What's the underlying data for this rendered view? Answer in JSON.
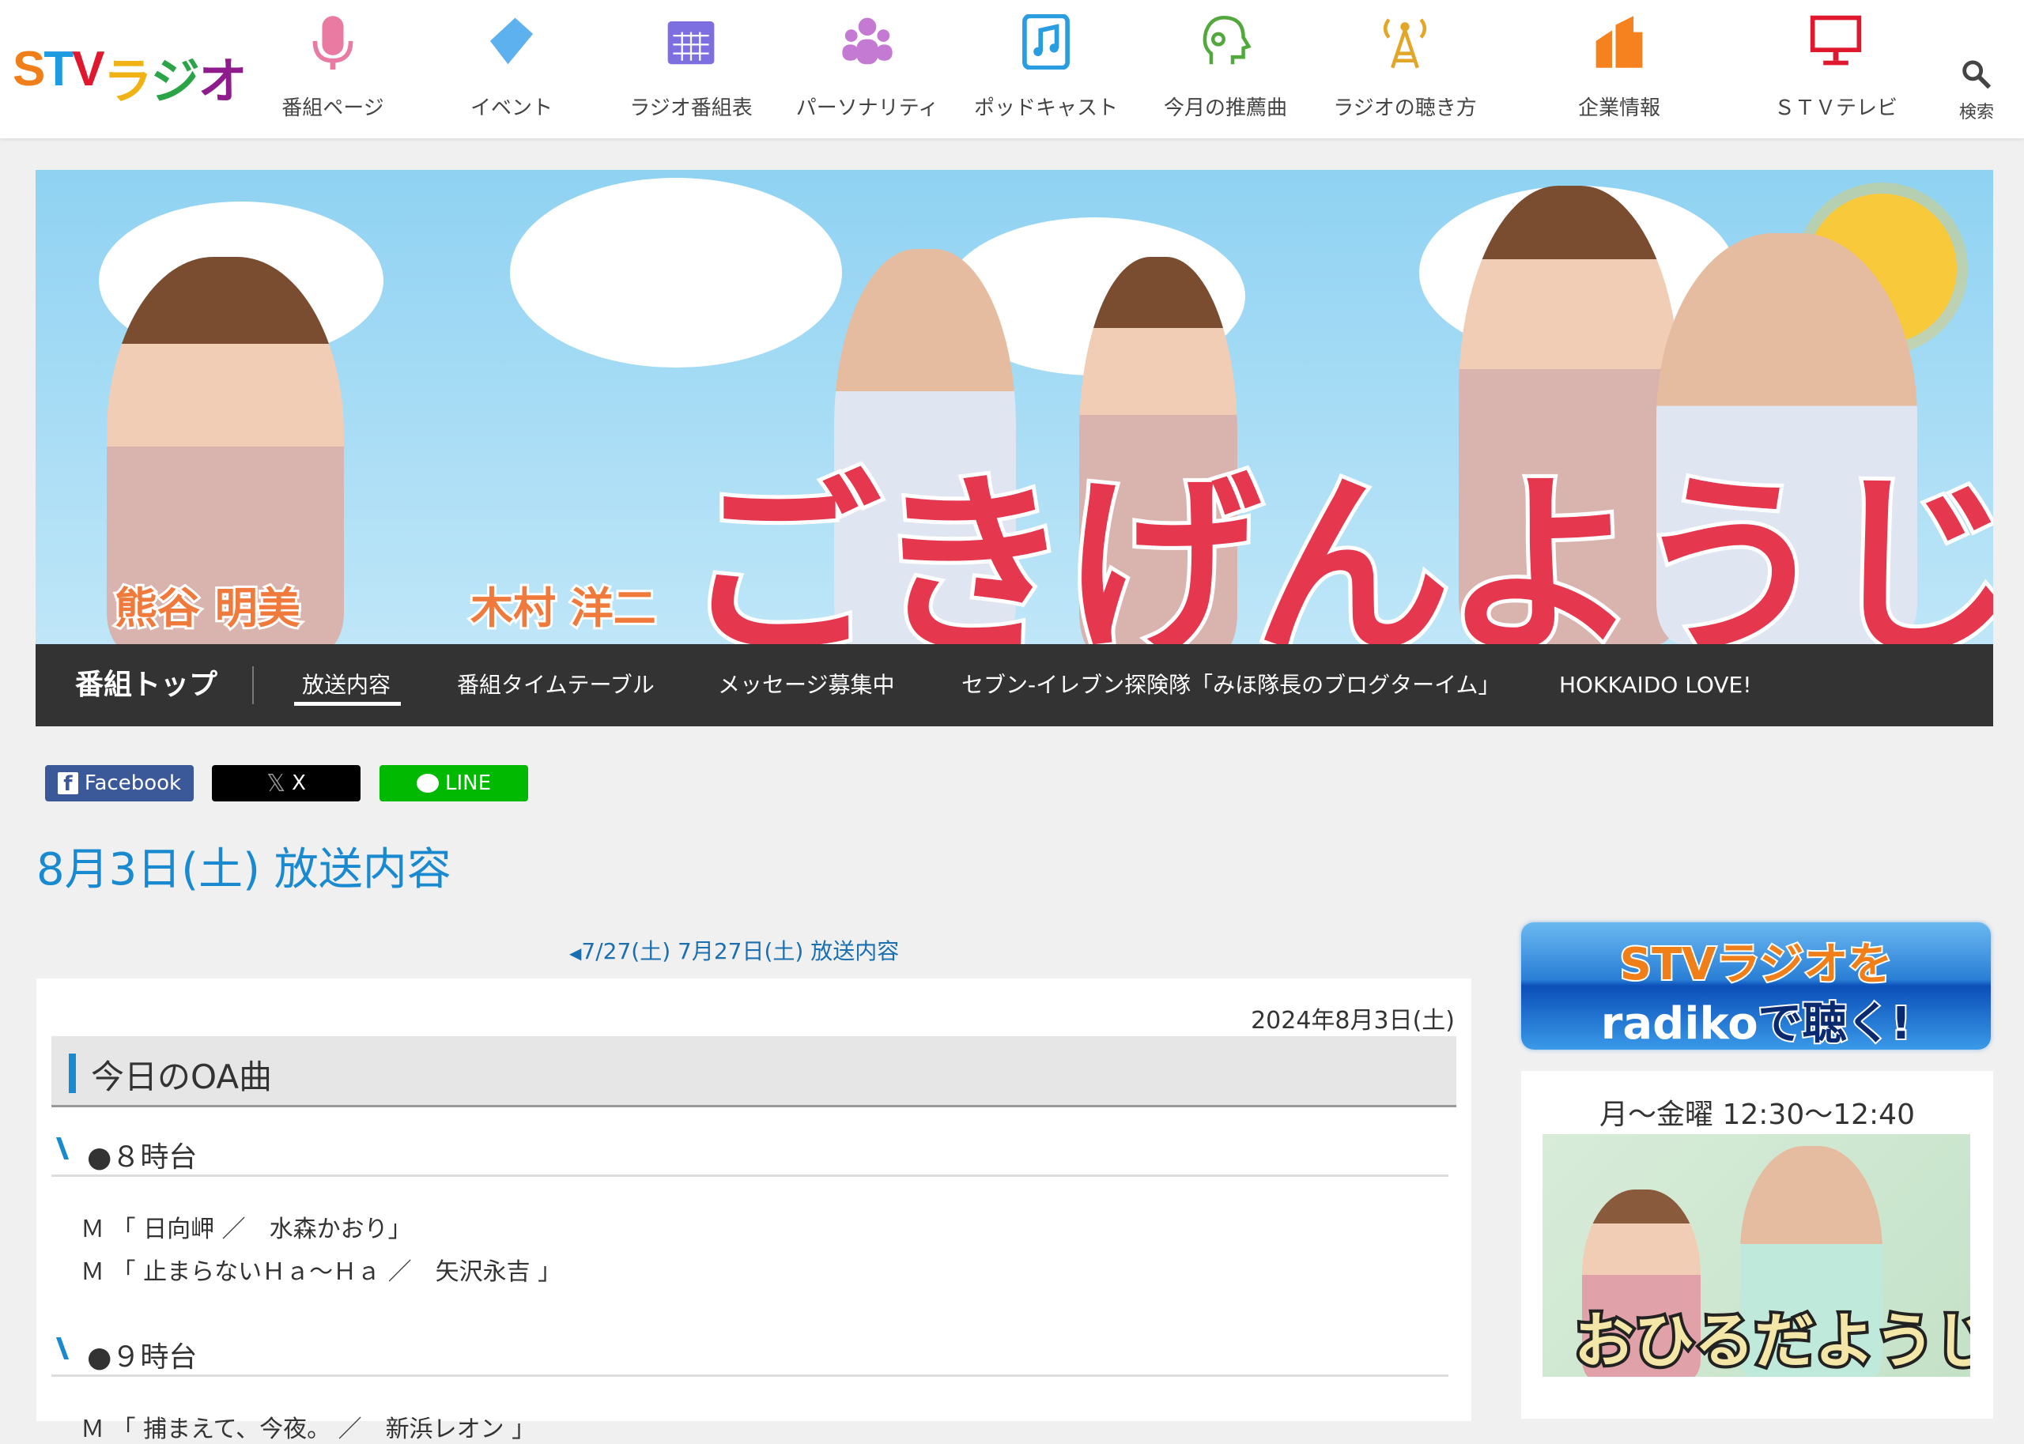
{
  "header": {
    "logo": {
      "chars": [
        "S",
        "T",
        "V",
        "ラ",
        "ジ",
        "オ"
      ],
      "colors": [
        "#f07f1a",
        "#1c9be0",
        "#e0182d",
        "#f0b215",
        "#2aa447",
        "#8e1c8c"
      ]
    },
    "nav": [
      {
        "label": "番組ページ",
        "icon": "microphone-icon",
        "color": "#e97aa2"
      },
      {
        "label": "イベント",
        "icon": "ticket-icon",
        "color": "#5db1ee"
      },
      {
        "label": "ラジオ番組表",
        "icon": "calendar-grid-icon",
        "color": "#7d6fe0"
      },
      {
        "label": "パーソナリティ",
        "icon": "people-icon",
        "color": "#c47ad2"
      },
      {
        "label": "ポッドキャスト",
        "icon": "music-note-icon",
        "color": "#2a9ce0"
      },
      {
        "label": "今月の推薦曲",
        "icon": "head-headphones-icon",
        "color": "#52a83c"
      },
      {
        "label": "ラジオの聴き方",
        "icon": "antenna-tower-icon",
        "color": "#e2a628"
      },
      {
        "label": "企業情報",
        "icon": "building-icon",
        "color": "#f5821f"
      },
      {
        "label": "ＳＴＶテレビ",
        "icon": "tv-monitor-icon",
        "color": "#e0182d"
      },
      {
        "label": "検索",
        "icon": "search-icon",
        "color": "#444444"
      }
    ]
  },
  "banner": {
    "title": "ごきげんようじ",
    "hosts": [
      "熊谷 明美",
      "木村 洋二"
    ]
  },
  "program_nav": {
    "top": "番組トップ",
    "items": [
      "放送内容",
      "番組タイムテーブル",
      "メッセージ募集中",
      "セブン-イレブン探険隊「みほ隊長のブログターイム」",
      "HOKKAIDO LOVE!"
    ],
    "active": 0
  },
  "share": {
    "facebook": "Facebook",
    "x": "X",
    "line": "LINE"
  },
  "page_title": "8月3日(土) 放送内容",
  "prev_link": "7/27(土) 7月27日(土) 放送内容",
  "article": {
    "date": "2024年8月3日(土)",
    "section_title": "今日のOA曲",
    "hours": [
      {
        "label": "●８時台",
        "songs": [
          "Ｍ 「 日向岬 ／　水森かおり」",
          "Ｍ 「 止まらないＨａ〜Ｈａ ／　矢沢永吉 」"
        ]
      },
      {
        "label": "●９時台",
        "songs": [
          "Ｍ 「 捕まえて、今夜。 ／　新浜レオン 」"
        ]
      }
    ]
  },
  "sidebar": {
    "radiko_banner": {
      "line1": "STVラジオを",
      "line2_a": "radiko",
      "line2_b": "で聴く!"
    },
    "program_time": "月～金曜 12:30～12:40",
    "program_logo": "おひるだようじ"
  },
  "accent": "#1a8ad0"
}
